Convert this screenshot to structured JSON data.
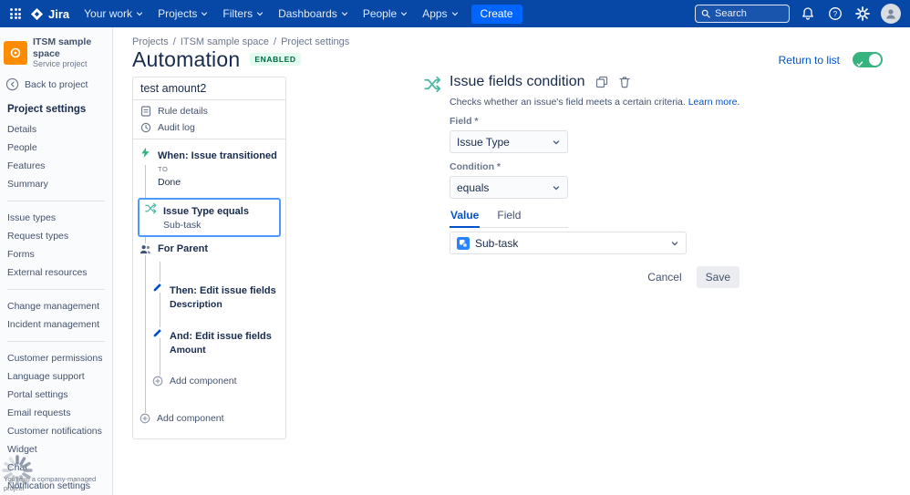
{
  "nav": {
    "brand": "Jira",
    "items": [
      "Your work",
      "Projects",
      "Filters",
      "Dashboards",
      "People",
      "Apps"
    ],
    "create_label": "Create",
    "search_placeholder": "Search"
  },
  "sidebar": {
    "project_name": "ITSM sample space",
    "project_type": "Service project",
    "back_label": "Back to project",
    "heading": "Project settings",
    "group1": [
      "Details",
      "People",
      "Features",
      "Summary"
    ],
    "group2": [
      "Issue types",
      "Request types",
      "Forms",
      "External resources"
    ],
    "group3": [
      "Change management",
      "Incident management"
    ],
    "group4": [
      "Customer permissions",
      "Language support",
      "Portal settings",
      "Email requests",
      "Customer notifications",
      "Widget",
      "Chat",
      "Notification settings"
    ],
    "footer": "You're in a company-managed project"
  },
  "breadcrumb": {
    "items": [
      "Projects",
      "ITSM sample space",
      "Project settings"
    ],
    "separator": "/"
  },
  "page": {
    "title": "Automation",
    "status_badge": "ENABLED",
    "return_to_list": "Return to list"
  },
  "rule": {
    "name": "test amount2",
    "rule_details_label": "Rule details",
    "audit_log_label": "Audit log",
    "trigger_title": "When: Issue transitioned",
    "trigger_sub_label": "TO",
    "trigger_sub_value": "Done",
    "condition_title": "Issue Type equals",
    "condition_sub": "Sub-task",
    "branch_title": "For Parent",
    "action1_title": "Then: Edit issue fields",
    "action1_sub": "Description",
    "action2_title": "And: Edit issue fields",
    "action2_sub": "Amount",
    "add_component_label": "Add component"
  },
  "detail": {
    "title": "Issue fields condition",
    "description": "Checks whether an issue's field meets a certain criteria.",
    "learn_more": "Learn more.",
    "field_label": "Field *",
    "field_value": "Issue Type",
    "condition_label": "Condition *",
    "condition_value": "equals",
    "tab_value": "Value",
    "tab_field": "Field",
    "value_select": "Sub-task",
    "cancel_label": "Cancel",
    "save_label": "Save"
  },
  "colors": {
    "nav_bg": "#0747A6",
    "accent_blue": "#0052CC",
    "selected_border": "#4C9AFF",
    "toggle_on": "#36B37E",
    "badge_bg": "#E3FCEF",
    "badge_text": "#006644"
  }
}
